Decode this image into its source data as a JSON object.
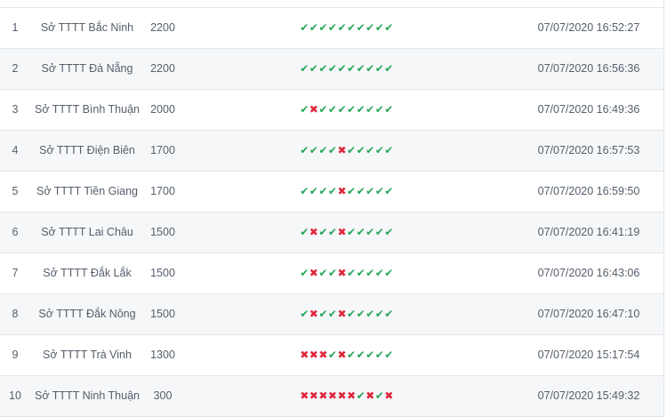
{
  "rows": [
    {
      "rank": "1",
      "name": "Sở TTTT Bắc Ninh",
      "score": "2200",
      "answers": [
        true,
        true,
        true,
        true,
        true,
        true,
        true,
        true,
        true,
        true
      ],
      "time": "07/07/2020 16:52:27"
    },
    {
      "rank": "2",
      "name": "Sở TTTT Đà Nẵng",
      "score": "2200",
      "answers": [
        true,
        true,
        true,
        true,
        true,
        true,
        true,
        true,
        true,
        true
      ],
      "time": "07/07/2020 16:56:36"
    },
    {
      "rank": "3",
      "name": "Sở TTTT Bình Thuận",
      "score": "2000",
      "answers": [
        true,
        false,
        true,
        true,
        true,
        true,
        true,
        true,
        true,
        true
      ],
      "time": "07/07/2020 16:49:36"
    },
    {
      "rank": "4",
      "name": "Sở TTTT Điện Biên",
      "score": "1700",
      "answers": [
        true,
        true,
        true,
        true,
        false,
        true,
        true,
        true,
        true,
        true
      ],
      "time": "07/07/2020 16:57:53"
    },
    {
      "rank": "5",
      "name": "Sở TTTT Tiền Giang",
      "score": "1700",
      "answers": [
        true,
        true,
        true,
        true,
        false,
        true,
        true,
        true,
        true,
        true
      ],
      "time": "07/07/2020 16:59:50"
    },
    {
      "rank": "6",
      "name": "Sở TTTT Lai Châu",
      "score": "1500",
      "answers": [
        true,
        false,
        true,
        true,
        false,
        true,
        true,
        true,
        true,
        true
      ],
      "time": "07/07/2020 16:41:19"
    },
    {
      "rank": "7",
      "name": "Sở TTTT Đắk Lắk",
      "score": "1500",
      "answers": [
        true,
        false,
        true,
        true,
        false,
        true,
        true,
        true,
        true,
        true
      ],
      "time": "07/07/2020 16:43:06"
    },
    {
      "rank": "8",
      "name": "Sở TTTT Đắk Nông",
      "score": "1500",
      "answers": [
        true,
        false,
        true,
        true,
        false,
        true,
        true,
        true,
        true,
        true
      ],
      "time": "07/07/2020 16:47:10"
    },
    {
      "rank": "9",
      "name": "Sở TTTT Trà Vinh",
      "score": "1300",
      "answers": [
        false,
        false,
        false,
        true,
        false,
        true,
        true,
        true,
        true,
        true
      ],
      "time": "07/07/2020 15:17:54"
    },
    {
      "rank": "10",
      "name": "Sở TTTT Ninh Thuận",
      "score": "300",
      "answers": [
        false,
        false,
        false,
        false,
        false,
        false,
        true,
        false,
        true,
        false
      ],
      "time": "07/07/2020 15:49:32"
    }
  ],
  "icons": {
    "correct": "check-icon",
    "wrong": "cross-icon"
  },
  "colors": {
    "correct": "#26a65b",
    "wrong": "#e0263a",
    "row_alt": "#f6f7f8",
    "text": "#555e6b",
    "border": "#e3e6ea"
  }
}
